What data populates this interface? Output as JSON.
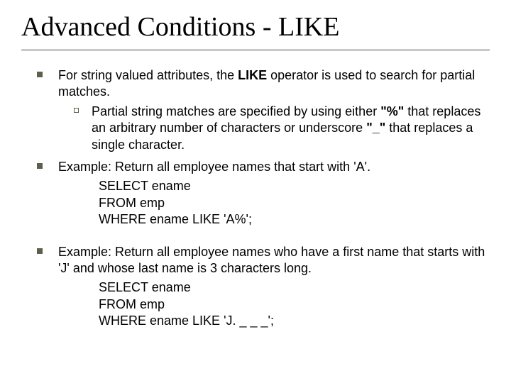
{
  "title": "Advanced Conditions - LIKE",
  "bullet1": {
    "prefix": "For string valued attributes, the ",
    "likeWord": "LIKE",
    "suffix": " operator is used to search for partial matches.",
    "sub": {
      "p1": "Partial string matches are specified by using either ",
      "pct": "\"%\"",
      "p2": " that replaces an arbitrary number of characters or underscore ",
      "und": "\"_\"",
      "p3": " that replaces a single character."
    }
  },
  "bullet2": {
    "text": "Example: Return all employee names that start with 'A'.",
    "code1": "SELECT ename",
    "code2": "FROM emp",
    "code3": "WHERE ename LIKE 'A%';"
  },
  "bullet3": {
    "text": "Example: Return all employee names who have a first name that starts with 'J' and whose last name is 3 characters long.",
    "code1": "SELECT ename",
    "code2": "FROM emp",
    "code3": "WHERE ename LIKE 'J. _ _ _';"
  }
}
